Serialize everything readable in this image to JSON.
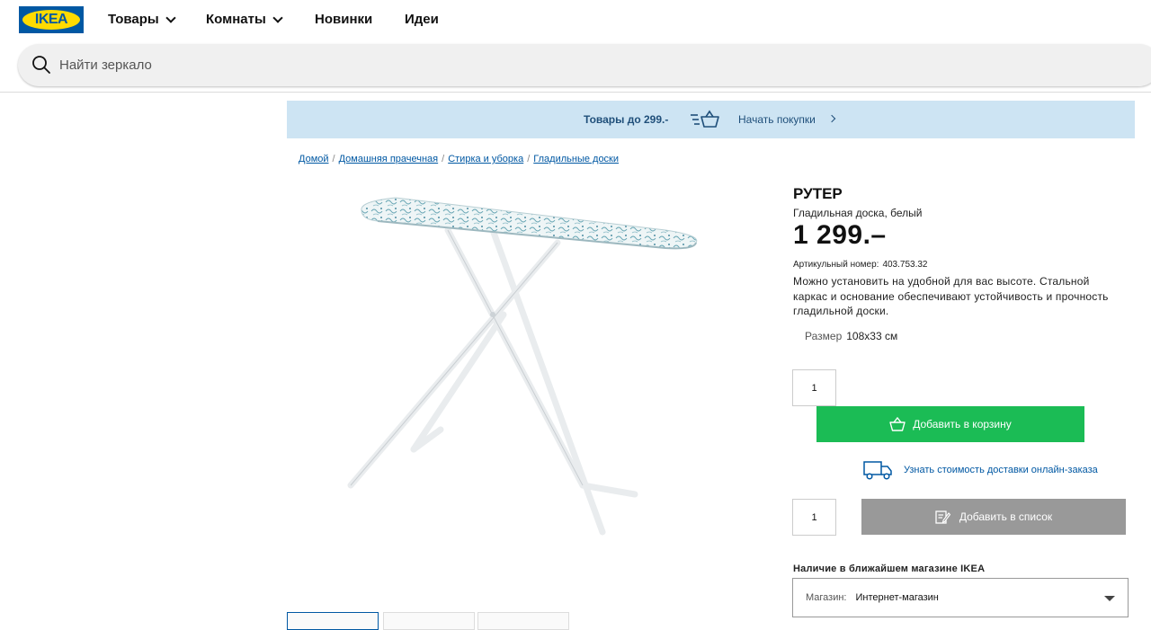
{
  "header": {
    "logo_text": "IKEA",
    "nav": [
      {
        "label": "Товары",
        "dropdown": true
      },
      {
        "label": "Комнаты",
        "dropdown": true
      },
      {
        "label": "Новинки",
        "dropdown": false
      },
      {
        "label": "Идеи",
        "dropdown": false
      }
    ],
    "search": {
      "placeholder": "Найти зеркало",
      "value": ""
    }
  },
  "promo": {
    "text": "Товары до 299.-",
    "link": "Начать покупки"
  },
  "breadcrumb": [
    "Домой",
    "Домашняя прачечная",
    "Стирка и уборка",
    "Гладильные доски"
  ],
  "breadcrumb_separator": "/",
  "product": {
    "name": "РУТЕР",
    "description": "Гладильная доска, белый",
    "price": "1 299.–",
    "article_label": "Артикульный номер:",
    "article_number": "403.753.32",
    "text": "Можно установить на удобной для вас высоте. Стальной каркас и основание обеспечивают устойчивость и прочность гладильной доски.",
    "size_label": "Размер",
    "size_value": "108x33 см"
  },
  "purchase": {
    "cart_qty": "1",
    "add_to_cart": "Добавить в корзину",
    "delivery_link": "Узнать стоимость доставки онлайн-заказа",
    "list_qty": "1",
    "add_to_list": "Добавить в список"
  },
  "store": {
    "title": "Наличие в ближайшем магазине IKEA",
    "label": "Магазин:",
    "value": "Интернет-магазин"
  },
  "colors": {
    "brand_blue": "#0058a3",
    "brand_yellow": "#ffdb00",
    "cart_green": "#1bbc55",
    "promo_bg": "#cde4f3",
    "list_gray": "#999999"
  },
  "icons": [
    "search-icon",
    "chevron-down-icon",
    "basket-icon",
    "chevron-right-icon",
    "truck-icon",
    "list-edit-icon",
    "caret-down-icon"
  ]
}
